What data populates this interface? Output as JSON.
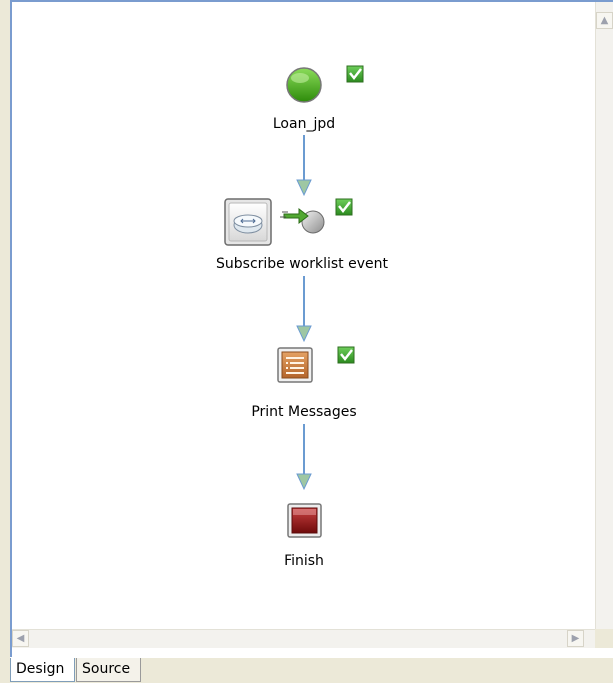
{
  "canvas": {
    "nodes": [
      {
        "label": "Loan_jpd",
        "icon": "start-node-icon"
      },
      {
        "label": "Subscribe worklist event",
        "icon": "subscribe-event-icon"
      },
      {
        "label": "Print Messages",
        "icon": "print-messages-icon"
      },
      {
        "label": "Finish",
        "icon": "finish-node-icon"
      }
    ]
  },
  "tabs": [
    {
      "label": "Design",
      "active": true
    },
    {
      "label": "Source",
      "active": false
    }
  ],
  "colors": {
    "connector": "#6b9bd1",
    "start": "#3aa012",
    "check": "#3ba12b",
    "finish": "#8c1414",
    "print": "#c9793a"
  }
}
